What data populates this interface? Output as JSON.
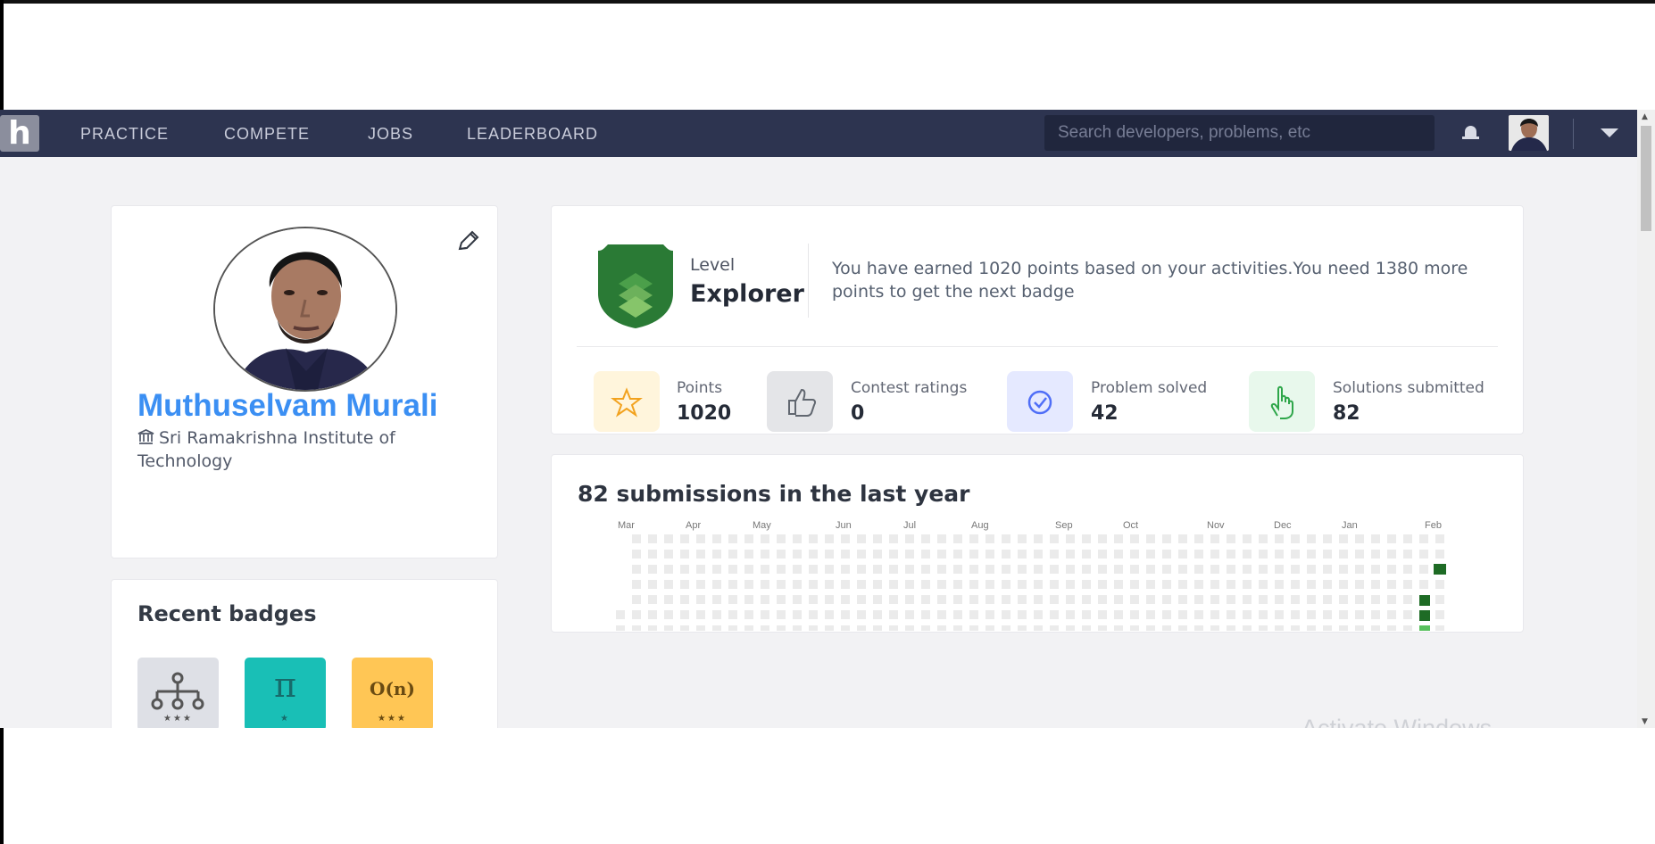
{
  "navigation": {
    "logo_text": "h",
    "links": [
      "PRACTICE",
      "COMPETE",
      "JOBS",
      "LEADERBOARD"
    ],
    "search_placeholder": "Search developers, problems, etc"
  },
  "profile": {
    "name": "Muthuselvam Murali",
    "institution": "Sri Ramakrishna Institute of Technology"
  },
  "recent_badges": {
    "title": "Recent badges",
    "items": [
      {
        "symbol": "",
        "stars": "★★★"
      },
      {
        "symbol": "π",
        "stars": "★"
      },
      {
        "symbol": "O(n)",
        "stars": "★★★"
      }
    ]
  },
  "level": {
    "label": "Level",
    "name": "Explorer",
    "message": "You have earned 1020 points based on your activities.You need 1380 more points to get the next badge"
  },
  "stats": [
    {
      "label": "Points",
      "value": "1020"
    },
    {
      "label": "Contest ratings",
      "value": "0"
    },
    {
      "label": "Problem solved",
      "value": "42"
    },
    {
      "label": "Solutions submitted",
      "value": "82"
    }
  ],
  "submissions": {
    "title": "82 submissions in the last year",
    "months": [
      "Mar",
      "Apr",
      "May",
      "Jun",
      "Jul",
      "Aug",
      "Sep",
      "Oct",
      "Nov",
      "Dec",
      "Jan",
      "Feb"
    ],
    "active_levels": [
      {
        "level": "high"
      },
      {
        "level": "high"
      },
      {
        "level": "high"
      },
      {
        "level": "low"
      }
    ]
  },
  "watermark_text": "Activate Windows",
  "colors": {
    "nav_background": "#2d3450",
    "name_blue": "#3b8ff3",
    "explorer_green": "#2a7a35",
    "heatmap_empty": "#ebebeb",
    "heatmap_high": "#1e6b25",
    "heatmap_low": "#58c05d"
  }
}
